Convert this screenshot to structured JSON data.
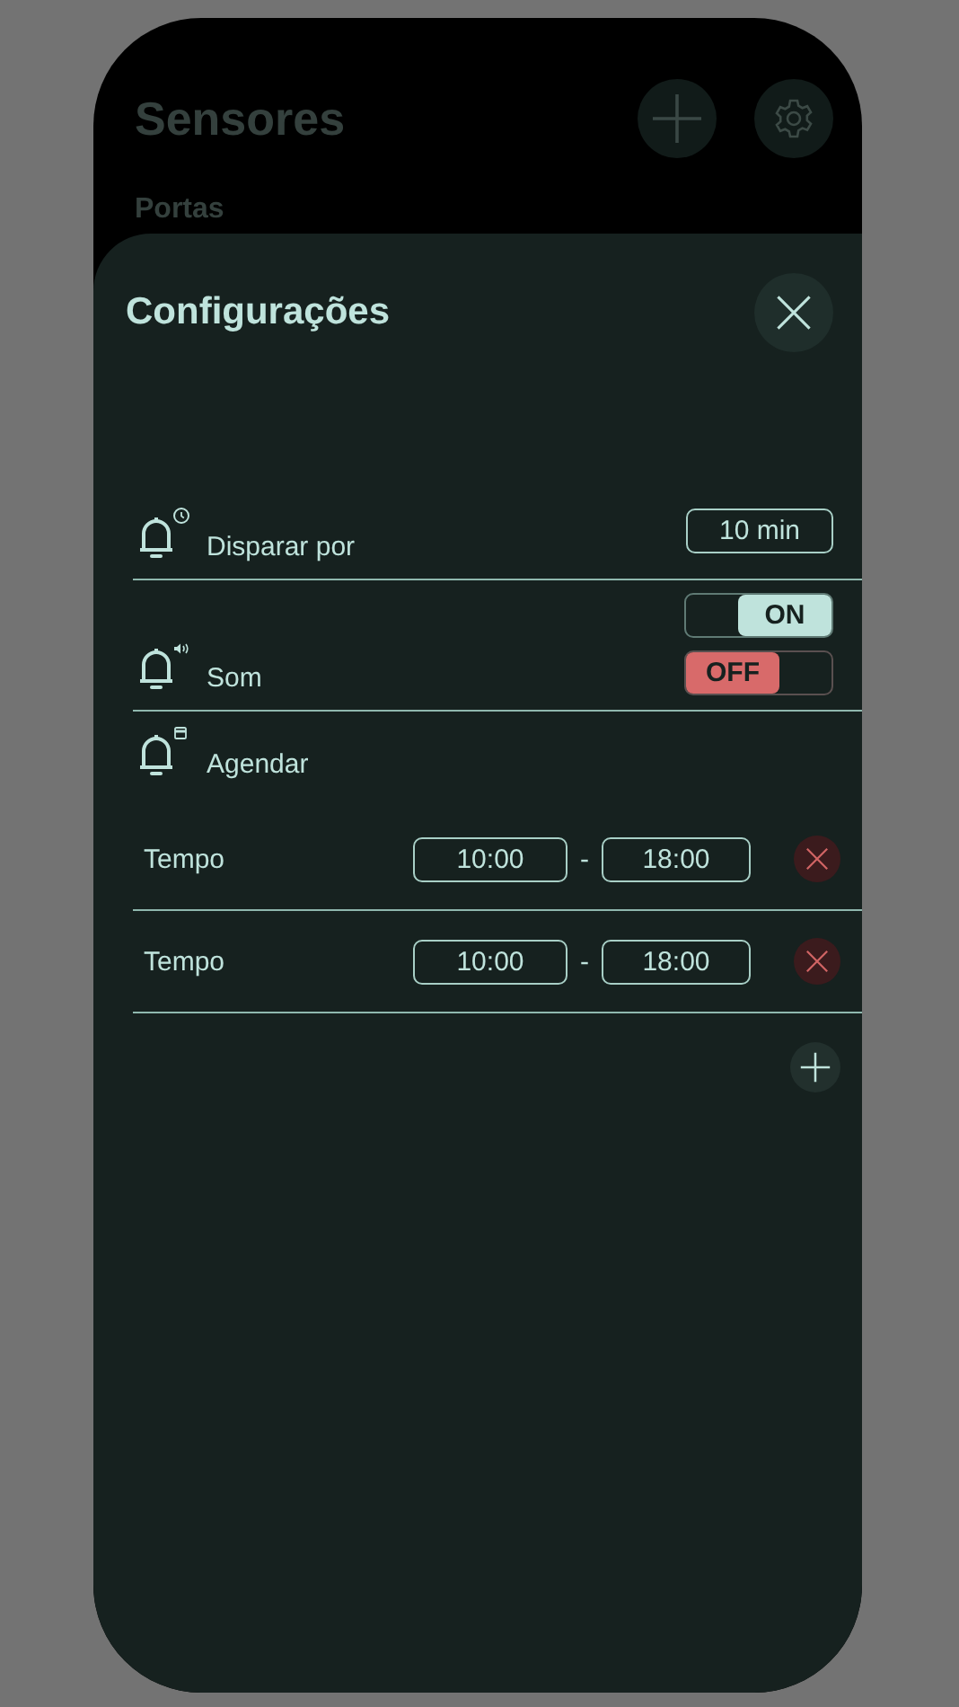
{
  "background": {
    "title": "Sensores",
    "section_label": "Portas"
  },
  "sheet": {
    "title": "Configurações",
    "settings": [
      {
        "kind": "duration",
        "label": "Disparar por",
        "value": "10 min"
      },
      {
        "kind": "sound",
        "label": "Som",
        "toggles": [
          {
            "label": "ON",
            "on": true
          },
          {
            "label": "OFF",
            "on": false
          }
        ]
      },
      {
        "kind": "schedule",
        "label": "Agendar"
      }
    ],
    "schedule_rows": [
      {
        "label": "Tempo",
        "start": "10:00",
        "separator": "-",
        "end": "18:00"
      },
      {
        "label": "Tempo",
        "start": "10:00",
        "separator": "-",
        "end": "18:00"
      }
    ]
  }
}
